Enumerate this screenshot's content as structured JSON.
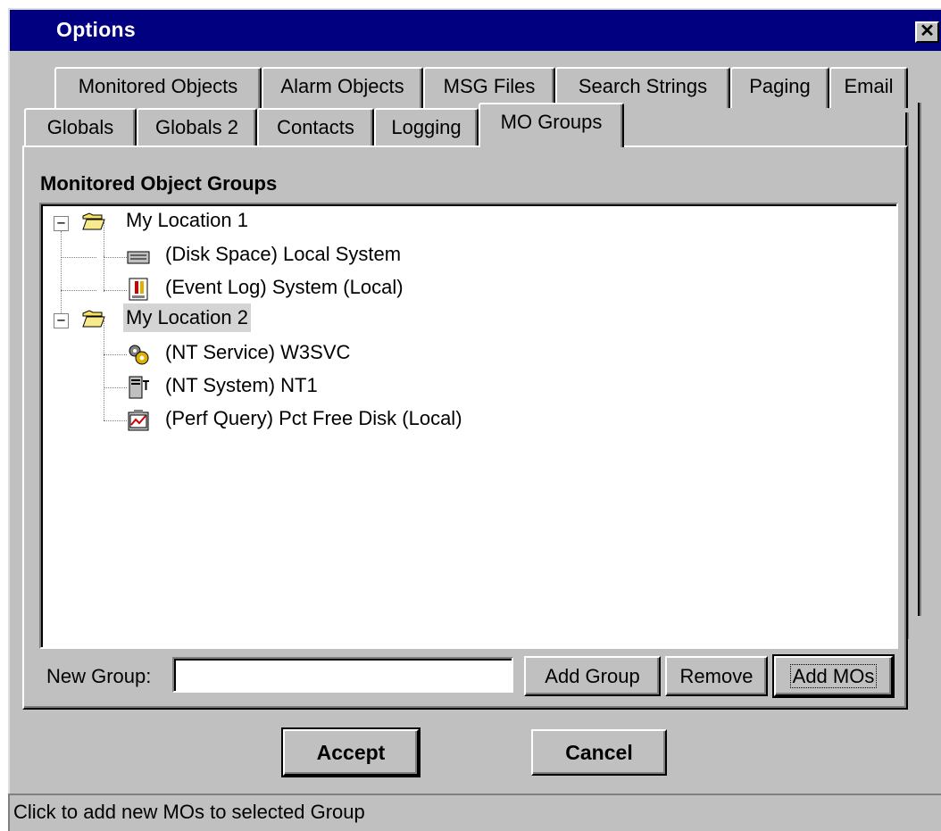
{
  "window": {
    "title": "Options",
    "close_glyph": "✕"
  },
  "tabs_row1": [
    {
      "label": "Monitored Objects"
    },
    {
      "label": "Alarm Objects"
    },
    {
      "label": "MSG Files"
    },
    {
      "label": "Search Strings"
    },
    {
      "label": "Paging"
    },
    {
      "label": "Email"
    }
  ],
  "tabs_row2": [
    {
      "label": "Globals"
    },
    {
      "label": "Globals 2"
    },
    {
      "label": "Contacts"
    },
    {
      "label": "Logging"
    },
    {
      "label": "MO Groups",
      "active": true
    }
  ],
  "section": {
    "title": "Monitored Object Groups"
  },
  "tree": {
    "groups": [
      {
        "label": "My Location 1",
        "expanded": true,
        "items": [
          {
            "label": "(Disk Space) Local System",
            "icon": "disk-space-icon"
          },
          {
            "label": "(Event Log) System (Local)",
            "icon": "event-log-icon"
          }
        ]
      },
      {
        "label": "My Location 2",
        "expanded": true,
        "selected": true,
        "items": [
          {
            "label": "(NT Service) W3SVC",
            "icon": "nt-service-icon"
          },
          {
            "label": "(NT System) NT1",
            "icon": "nt-system-icon"
          },
          {
            "label": "(Perf Query) Pct Free Disk (Local)",
            "icon": "perf-query-icon"
          }
        ]
      }
    ]
  },
  "new_group": {
    "label": "New Group:",
    "value": ""
  },
  "buttons": {
    "add_group": "Add Group",
    "remove": "Remove",
    "add_mos": "Add MOs",
    "accept": "Accept",
    "cancel": "Cancel"
  },
  "status": {
    "text": "Click to add new MOs to selected Group"
  },
  "colors": {
    "titlebar": "#000080",
    "face": "#c0c0c0",
    "shadow": "#808080",
    "highlight": "#ffffff",
    "selected": "#d4d4d4"
  }
}
